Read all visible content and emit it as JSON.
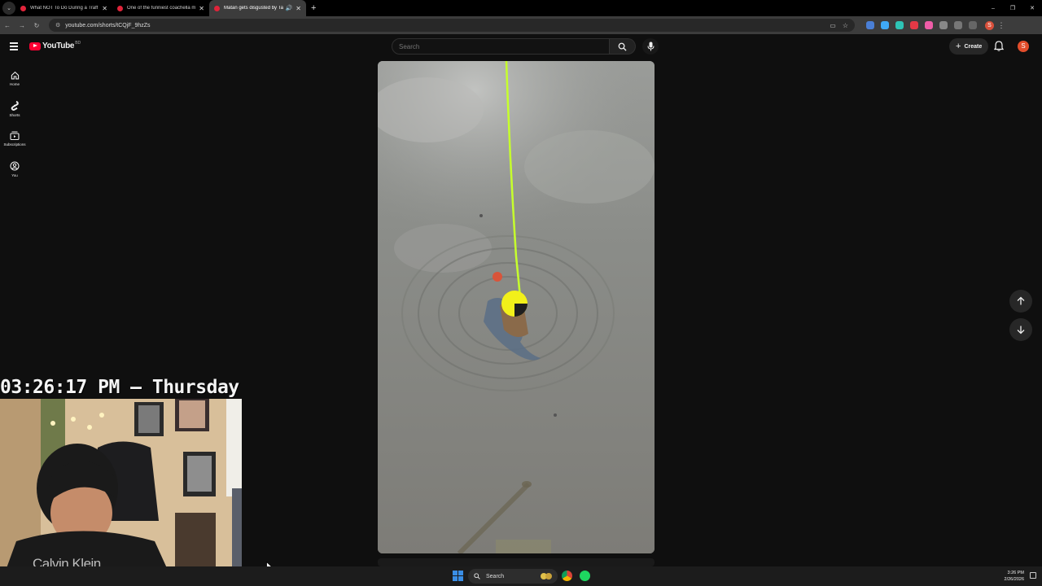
{
  "browser": {
    "tabs": [
      {
        "title": "What NOT To Do During a Traff",
        "active": false
      },
      {
        "title": "One of the funniest coachella m",
        "active": false
      },
      {
        "title": "Matan gets disgusted by Ta",
        "active": true
      }
    ],
    "url": "youtube.com/shorts/tCQjF_9hzZs",
    "window_controls": [
      "–",
      "❐",
      "✕"
    ],
    "profile_initial": "S"
  },
  "youtube": {
    "logo_text": "YouTube",
    "logo_region": "BD",
    "search": {
      "placeholder": "Search"
    },
    "create_label": "Create",
    "avatar_initial": "S",
    "sidebar": [
      {
        "label": "Home",
        "icon": "home-icon"
      },
      {
        "label": "Shorts",
        "icon": "shorts-icon"
      },
      {
        "label": "Subscriptions",
        "icon": "subscriptions-icon"
      },
      {
        "label": "You",
        "icon": "you-icon"
      }
    ]
  },
  "overlay": {
    "clock": "03:26:17 PM – Thursday",
    "shirt_brand": "Calvin Klein"
  },
  "taskbar": {
    "search_label": "Search",
    "time": "3:26 PM",
    "date": "2/26/2026"
  },
  "colors": {
    "yt_red": "#ff0033",
    "background": "#0f0f0f",
    "fishing_line": "#c6ff2c",
    "bobber": "#f2f01a"
  }
}
